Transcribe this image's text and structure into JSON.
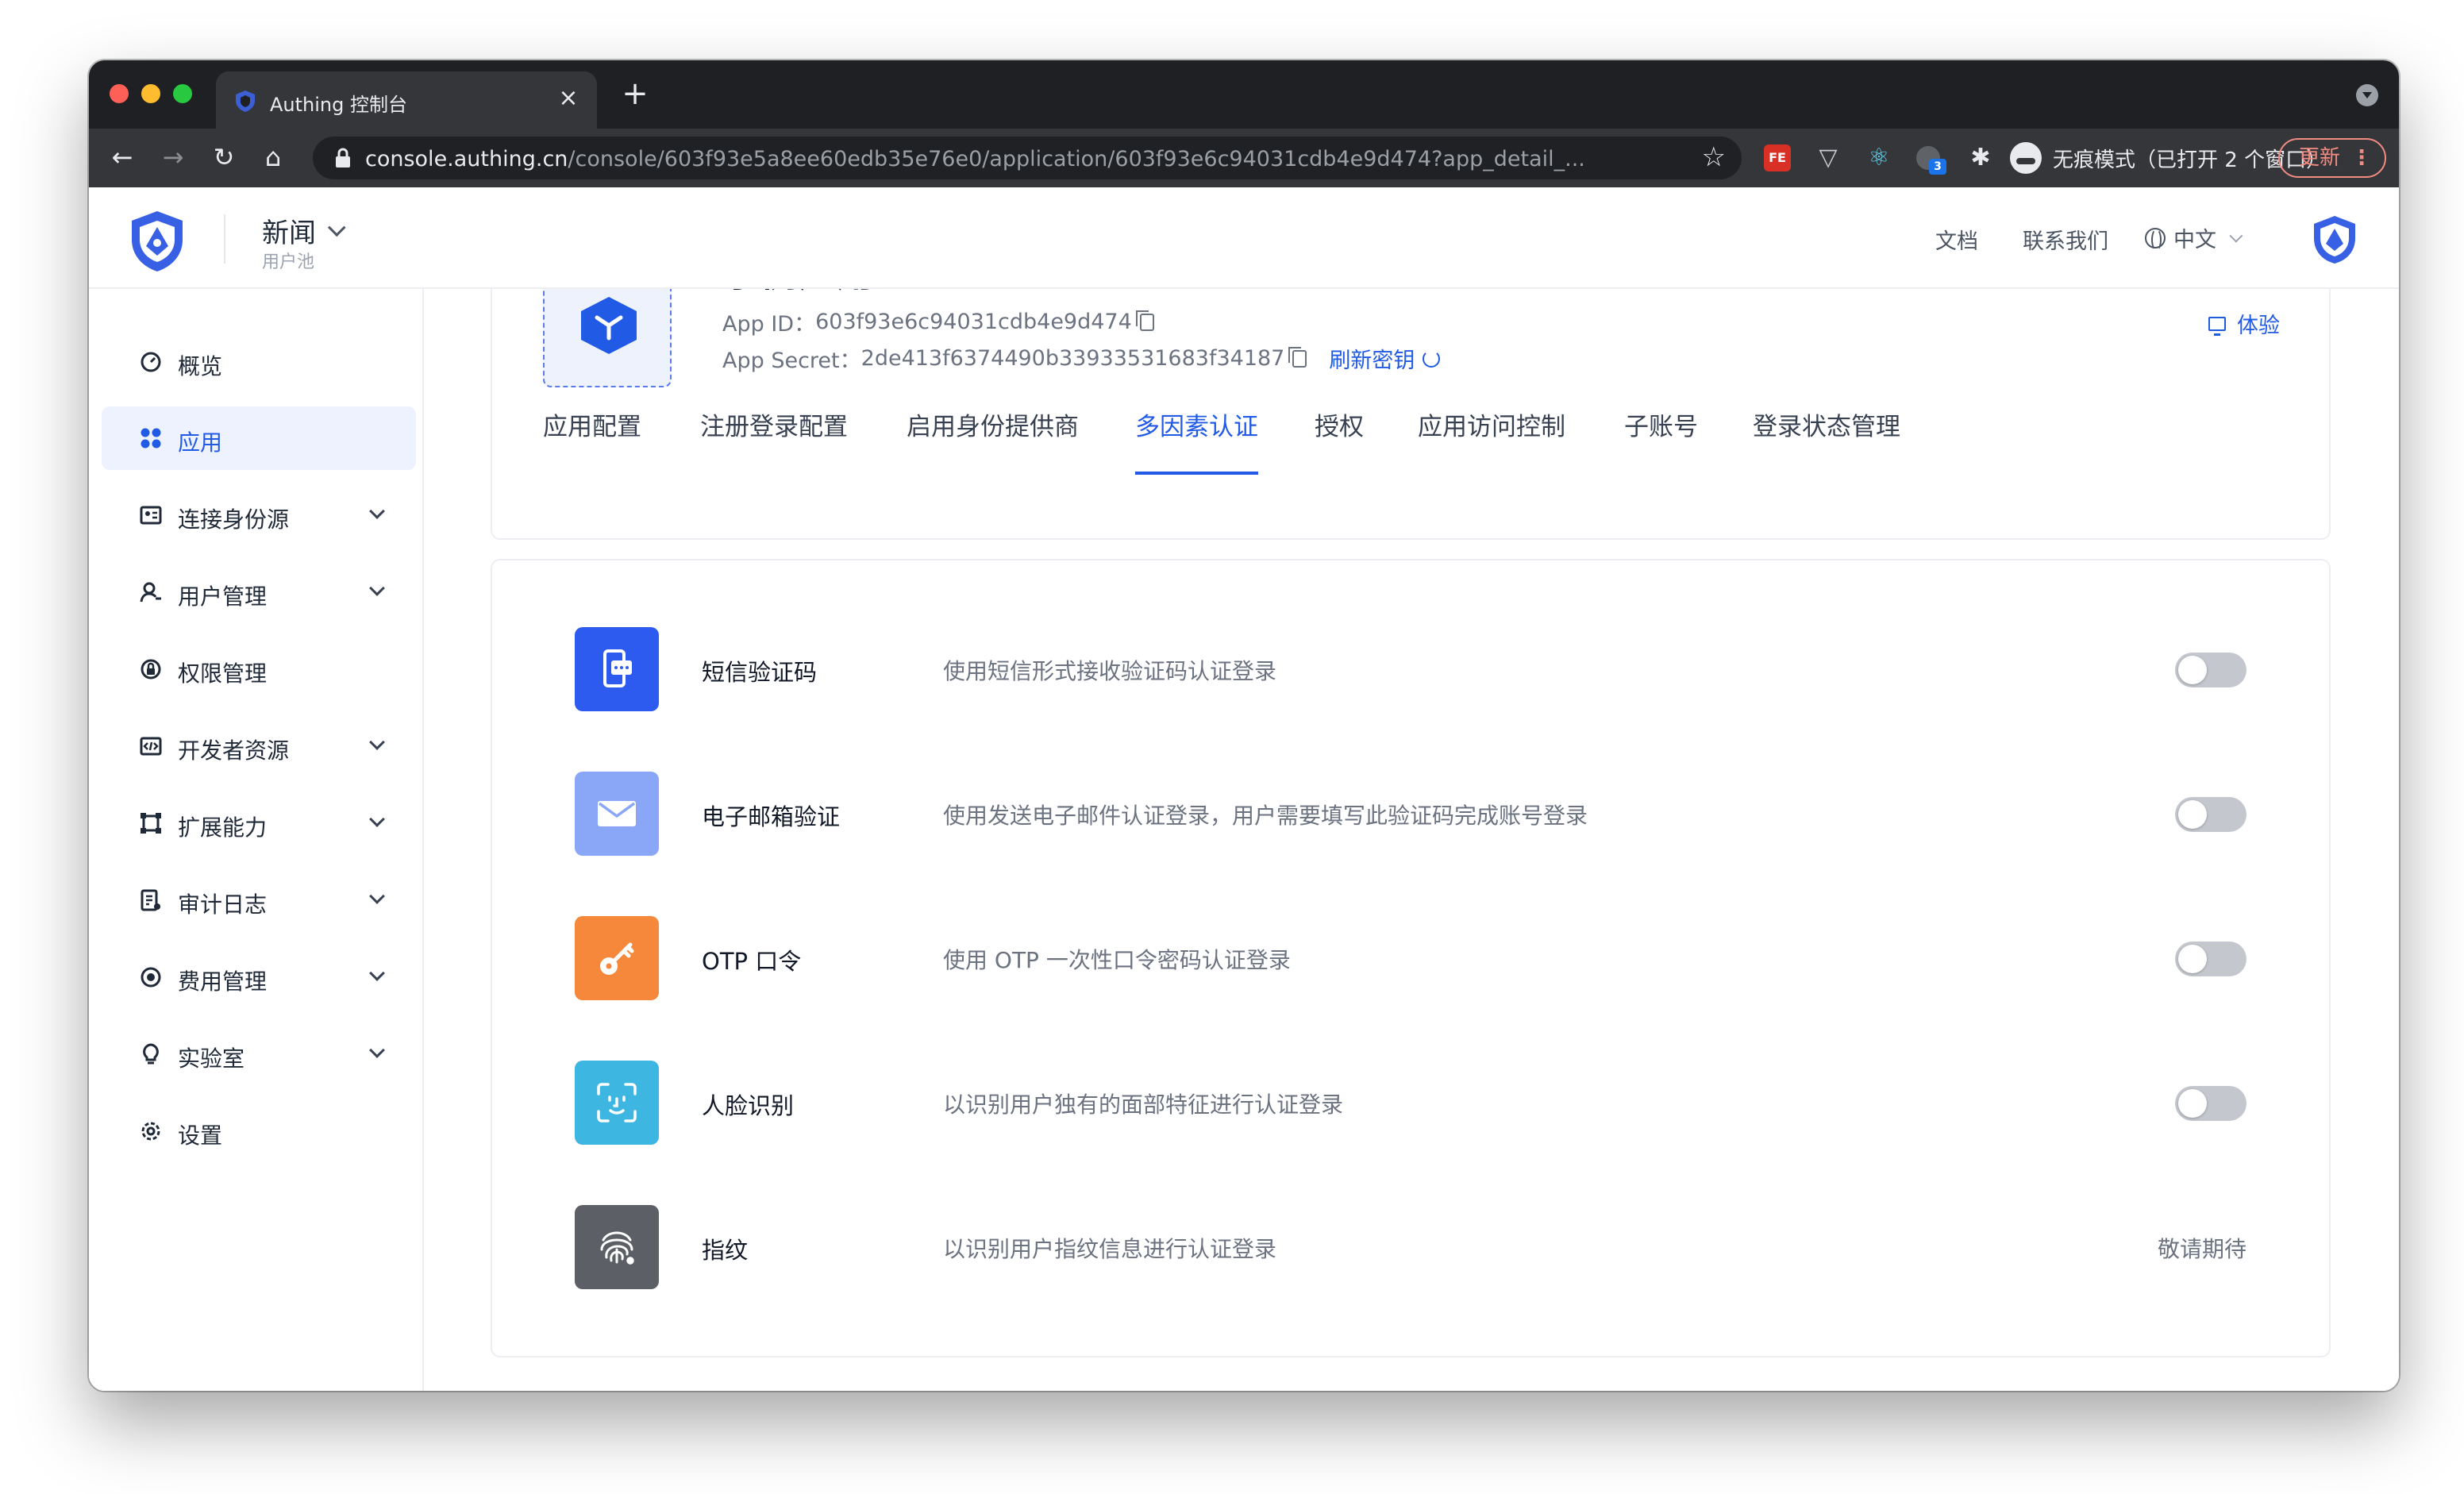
{
  "browser": {
    "tab_title": "Authing 控制台",
    "tab_close": "×",
    "new_tab": "+",
    "url_host": "console.authing.cn",
    "url_path": "/console/603f93e5a8ee60edb35e76e0/application/603f93e6c94031cdb4e9d474?app_detail_...",
    "ext_fe_label": "FE",
    "ext_dark_badge": "3",
    "incognito_label": "无痕模式（已打开 2 个窗口）",
    "update_label": "更新",
    "update_menu": "⋮"
  },
  "header": {
    "pool_name": "新闻",
    "pool_subtitle": "用户池",
    "docs": "文档",
    "contact": "联系我们",
    "language": "中文"
  },
  "sidebar": {
    "items": [
      {
        "label": "概览",
        "active": false,
        "expandable": false
      },
      {
        "label": "应用",
        "active": true,
        "expandable": false
      },
      {
        "label": "连接身份源",
        "active": false,
        "expandable": true
      },
      {
        "label": "用户管理",
        "active": false,
        "expandable": true
      },
      {
        "label": "权限管理",
        "active": false,
        "expandable": false
      },
      {
        "label": "开发者资源",
        "active": false,
        "expandable": true
      },
      {
        "label": "扩展能力",
        "active": false,
        "expandable": true
      },
      {
        "label": "审计日志",
        "active": false,
        "expandable": true
      },
      {
        "label": "费用管理",
        "active": false,
        "expandable": true
      },
      {
        "label": "实验室",
        "active": false,
        "expandable": true
      },
      {
        "label": "设置",
        "active": false,
        "expandable": false
      }
    ]
  },
  "app": {
    "name": "示例应用",
    "app_id_label": "App ID：",
    "app_id": "603f93e6c94031cdb4e9d474",
    "secret_label": "App Secret：",
    "secret": "2de413f6374490b33933531683f34187",
    "refresh_label": "刷新密钥",
    "try_label": "体验",
    "tabs": [
      {
        "label": "应用配置",
        "active": false
      },
      {
        "label": "注册登录配置",
        "active": false
      },
      {
        "label": "启用身份提供商",
        "active": false
      },
      {
        "label": "多因素认证",
        "active": true
      },
      {
        "label": "授权",
        "active": false
      },
      {
        "label": "应用访问控制",
        "active": false
      },
      {
        "label": "子账号",
        "active": false
      },
      {
        "label": "登录状态管理",
        "active": false
      }
    ]
  },
  "mfa": {
    "items": [
      {
        "name": "短信验证码",
        "desc": "使用短信形式接收验证码认证登录",
        "enabled": false,
        "icon": "sms-icon",
        "color": "#2d5bf0"
      },
      {
        "name": "电子邮箱验证",
        "desc": "使用发送电子邮件认证登录，用户需要填写此验证码完成账号登录",
        "enabled": false,
        "icon": "email-icon",
        "color": "#8aa6f6"
      },
      {
        "name": "OTP 口令",
        "desc": "使用 OTP 一次性口令密码认证登录",
        "enabled": false,
        "icon": "key-icon",
        "color": "#f5883b"
      },
      {
        "name": "人脸识别",
        "desc": "以识别用户独有的面部特征进行认证登录",
        "enabled": false,
        "icon": "face-icon",
        "color": "#3eb6e2"
      },
      {
        "name": "指纹",
        "desc": "以识别用户指纹信息进行认证登录",
        "status": "敬请期待",
        "icon": "fingerprint-icon",
        "color": "#5c5f66"
      }
    ]
  },
  "colors": {
    "accent": "#215ae5",
    "active_bg": "#eef2ff"
  }
}
